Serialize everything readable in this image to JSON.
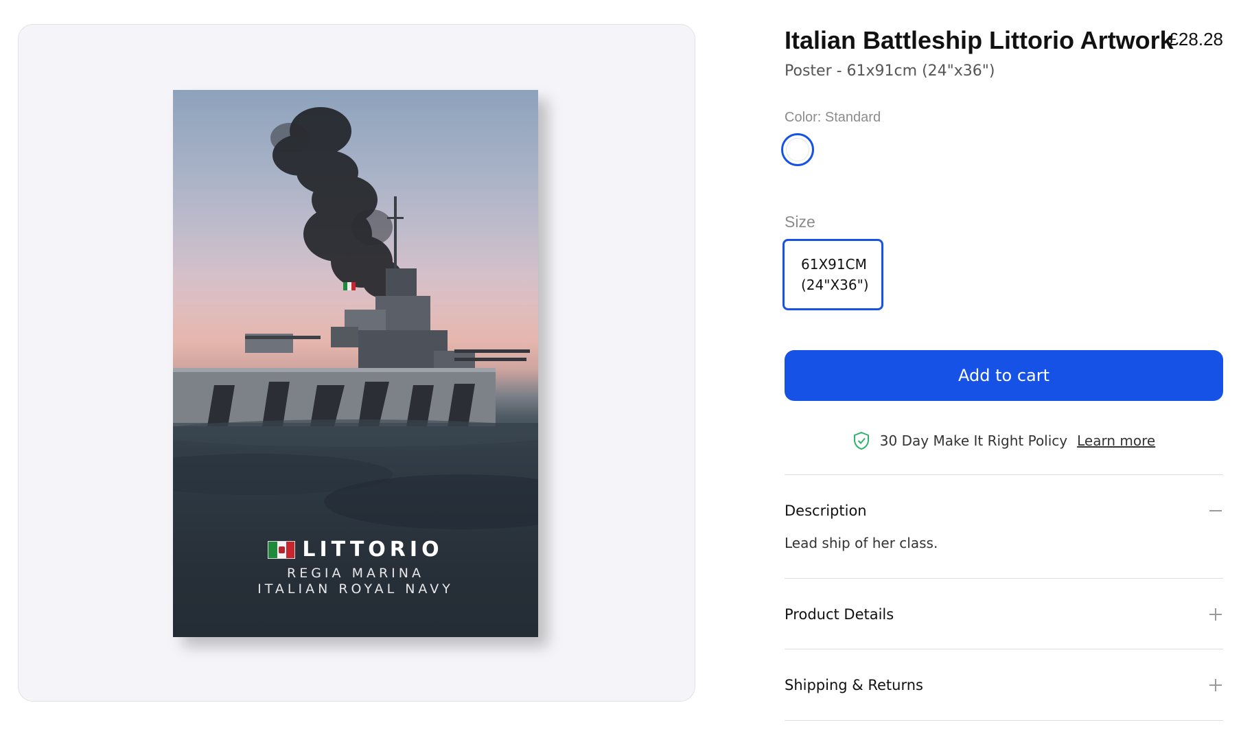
{
  "gallery": {
    "poster": {
      "title": "LITTORIO",
      "subtitle_line1": "REGIA MARINA",
      "subtitle_line2": "ITALIAN ROYAL NAVY"
    }
  },
  "product": {
    "title": "Italian Battleship Littorio Artwork",
    "price": "£28.28",
    "variant_summary": "Poster - 61x91cm (24\"x36\")",
    "color": {
      "label": "Color: Standard",
      "selected": "Standard"
    },
    "size": {
      "label": "Size",
      "options": [
        {
          "line1": "61X91CM",
          "line2": "(24\"X36\")"
        }
      ]
    },
    "add_to_cart_label": "Add to cart",
    "policy": {
      "text": "30 Day Make It Right Policy",
      "link_label": "Learn more"
    },
    "accordion": [
      {
        "title": "Description",
        "body": "Lead ship of her class.",
        "expanded": true
      },
      {
        "title": "Product Details",
        "expanded": false
      },
      {
        "title": "Shipping & Returns",
        "expanded": false
      }
    ]
  },
  "colors": {
    "accent": "#1652e6",
    "shield": "#2fb36b",
    "gallery_bg": "#f5f4f8"
  },
  "icons": [
    "shield-check-icon",
    "minus-icon",
    "plus-icon",
    "italian-flag-icon"
  ]
}
